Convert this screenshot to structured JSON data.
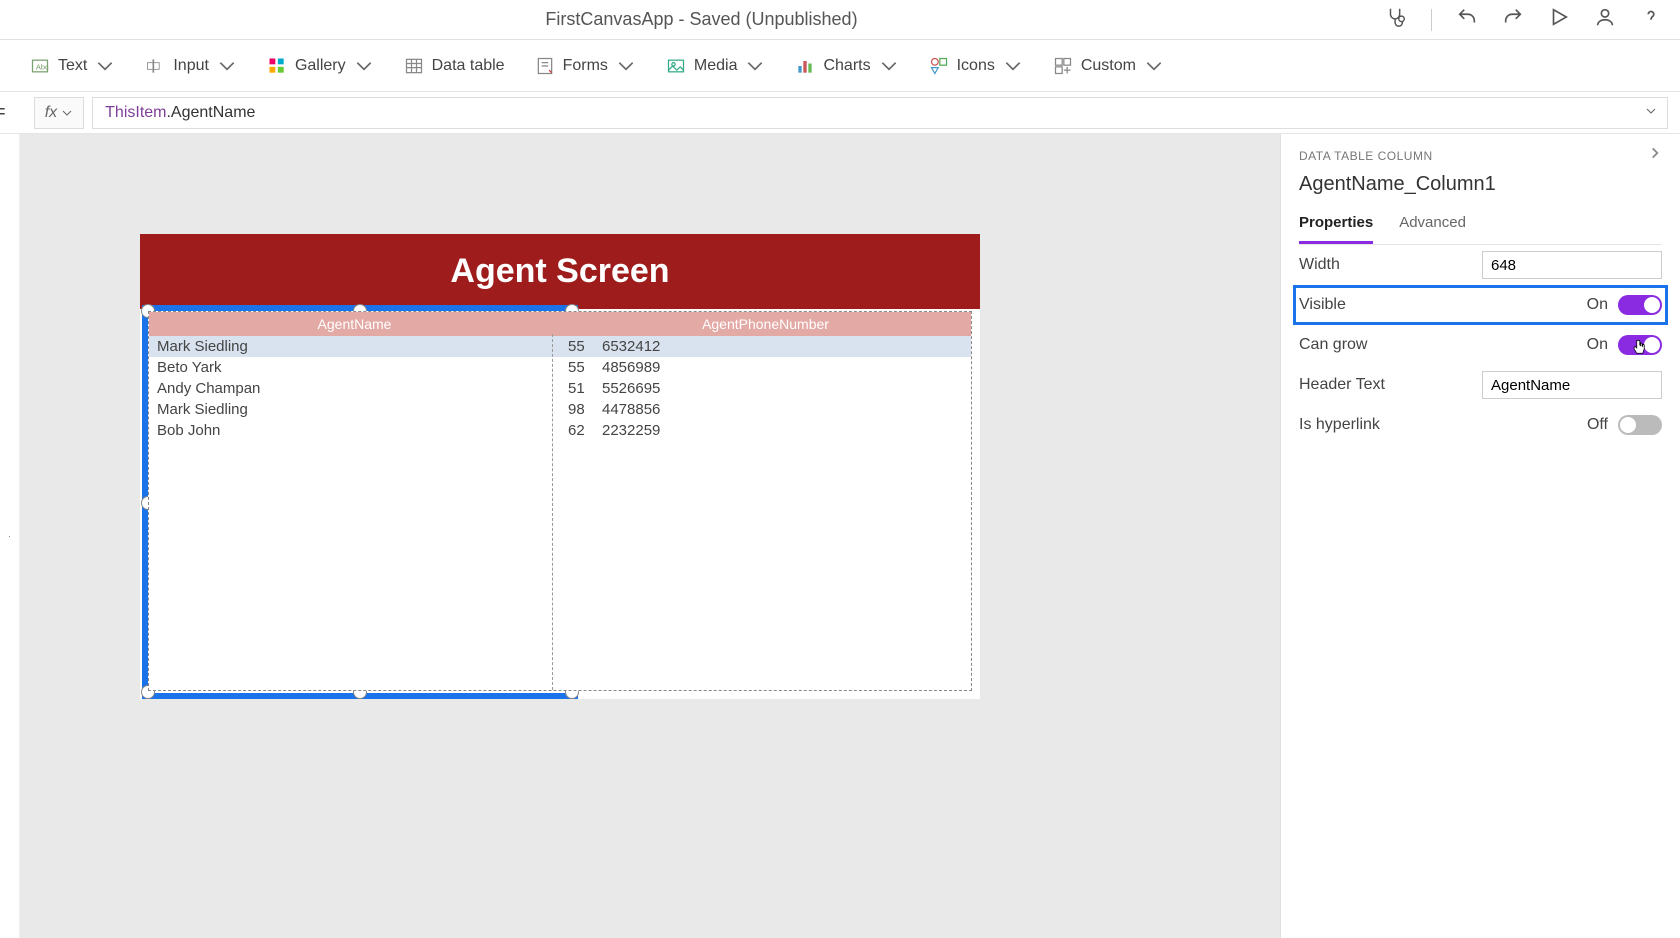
{
  "title_bar": {
    "app_title": "FirstCanvasApp - Saved (Unpublished)"
  },
  "ribbon": {
    "text": "Text",
    "input": "Input",
    "gallery": "Gallery",
    "data_table": "Data table",
    "forms": "Forms",
    "media": "Media",
    "charts": "Charts",
    "icons": "Icons",
    "custom": "Custom"
  },
  "formula": {
    "fx_label": "fx",
    "this_item": "ThisItem",
    "dot_prop": ".AgentName"
  },
  "canvas": {
    "header_title": "Agent Screen",
    "columns": [
      "AgentName",
      "AgentPhoneNumber"
    ],
    "rows": [
      {
        "name": "Mark Siedling",
        "phone_a": "55",
        "phone_b": "6532412"
      },
      {
        "name": "Beto Yark",
        "phone_a": "55",
        "phone_b": "4856989"
      },
      {
        "name": "Andy Champan",
        "phone_a": "51",
        "phone_b": "5526695"
      },
      {
        "name": "Mark Siedling",
        "phone_a": "98",
        "phone_b": "4478856"
      },
      {
        "name": "Bob John",
        "phone_a": "62",
        "phone_b": "2232259"
      }
    ]
  },
  "props": {
    "crumb": "DATA TABLE COLUMN",
    "object_name": "AgentName_Column1",
    "tabs": {
      "properties": "Properties",
      "advanced": "Advanced"
    },
    "width_label": "Width",
    "width_value": "648",
    "visible_label": "Visible",
    "visible_state": "On",
    "cangrow_label": "Can grow",
    "cangrow_state": "On",
    "headertext_label": "Header Text",
    "headertext_value": "AgentName",
    "hyperlink_label": "Is hyperlink",
    "hyperlink_state": "Off"
  }
}
